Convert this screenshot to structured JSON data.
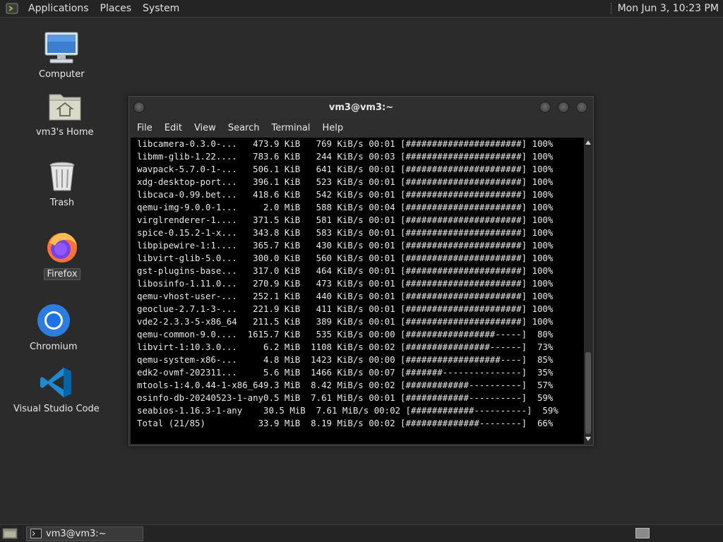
{
  "top_panel": {
    "menus": [
      "Applications",
      "Places",
      "System"
    ],
    "clock": "Mon Jun  3, 10:23 PM"
  },
  "desktop": {
    "icons": [
      {
        "label": "Computer",
        "icon": "computer-icon"
      },
      {
        "label": "vm3's Home",
        "icon": "home-folder-icon"
      },
      {
        "label": "Trash",
        "icon": "trash-icon"
      },
      {
        "label": "Firefox",
        "icon": "firefox-icon"
      },
      {
        "label": "Chromium",
        "icon": "chromium-icon"
      },
      {
        "label": "Visual Studio Code",
        "icon": "vscode-icon"
      }
    ]
  },
  "terminal": {
    "title": "vm3@vm3:~",
    "menu": [
      "File",
      "Edit",
      "View",
      "Search",
      "Terminal",
      "Help"
    ],
    "lines": [
      "libcamera-0.3.0-...   473.9 KiB   769 KiB/s 00:01 [######################] 100%",
      "libmm-glib-1.22....   783.6 KiB   244 KiB/s 00:03 [######################] 100%",
      "wavpack-5.7.0-1-...   506.1 KiB   641 KiB/s 00:01 [######################] 100%",
      "xdg-desktop-port...   396.1 KiB   523 KiB/s 00:01 [######################] 100%",
      "libcaca-0.99.bet...   418.6 KiB   542 KiB/s 00:01 [######################] 100%",
      "qemu-img-9.0.0-1...     2.0 MiB   588 KiB/s 00:04 [######################] 100%",
      "virglrenderer-1....   371.5 KiB   581 KiB/s 00:01 [######################] 100%",
      "spice-0.15.2-1-x...   343.8 KiB   583 KiB/s 00:01 [######################] 100%",
      "libpipewire-1:1....   365.7 KiB   430 KiB/s 00:01 [######################] 100%",
      "libvirt-glib-5.0...   300.0 KiB   560 KiB/s 00:01 [######################] 100%",
      "gst-plugins-base...   317.0 KiB   464 KiB/s 00:01 [######################] 100%",
      "libosinfo-1.11.0...   270.9 KiB   473 KiB/s 00:01 [######################] 100%",
      "qemu-vhost-user-...   252.1 KiB   440 KiB/s 00:01 [######################] 100%",
      "geoclue-2.7.1-3-...   221.9 KiB   411 KiB/s 00:01 [######################] 100%",
      "vde2-2.3.3-5-x86_64   211.5 KiB   389 KiB/s 00:01 [######################] 100%",
      "qemu-common-9.0....  1615.7 KiB   535 KiB/s 00:00 [#################-----]  80%",
      "libvirt-1:10.3.0...     6.2 MiB  1108 KiB/s 00:02 [################------]  73%",
      "qemu-system-x86-...     4.8 MiB  1423 KiB/s 00:00 [##################----]  85%",
      "edk2-ovmf-202311...     5.6 MiB  1466 KiB/s 00:07 [#######---------------]  35%",
      "mtools-1:4.0.44-1-x86_649.3 MiB  8.42 MiB/s 00:02 [############----------]  57%",
      "osinfo-db-20240523-1-any0.5 MiB  7.61 MiB/s 00:01 [############----------]  59%",
      "seabios-1.16.3-1-any    30.5 MiB  7.61 MiB/s 00:02 [############----------]  59%",
      "Total (21/85)          33.9 MiB  8.19 MiB/s 00:02 [##############--------]  66%"
    ]
  },
  "bottom_panel": {
    "task_label": "vm3@vm3:~"
  }
}
